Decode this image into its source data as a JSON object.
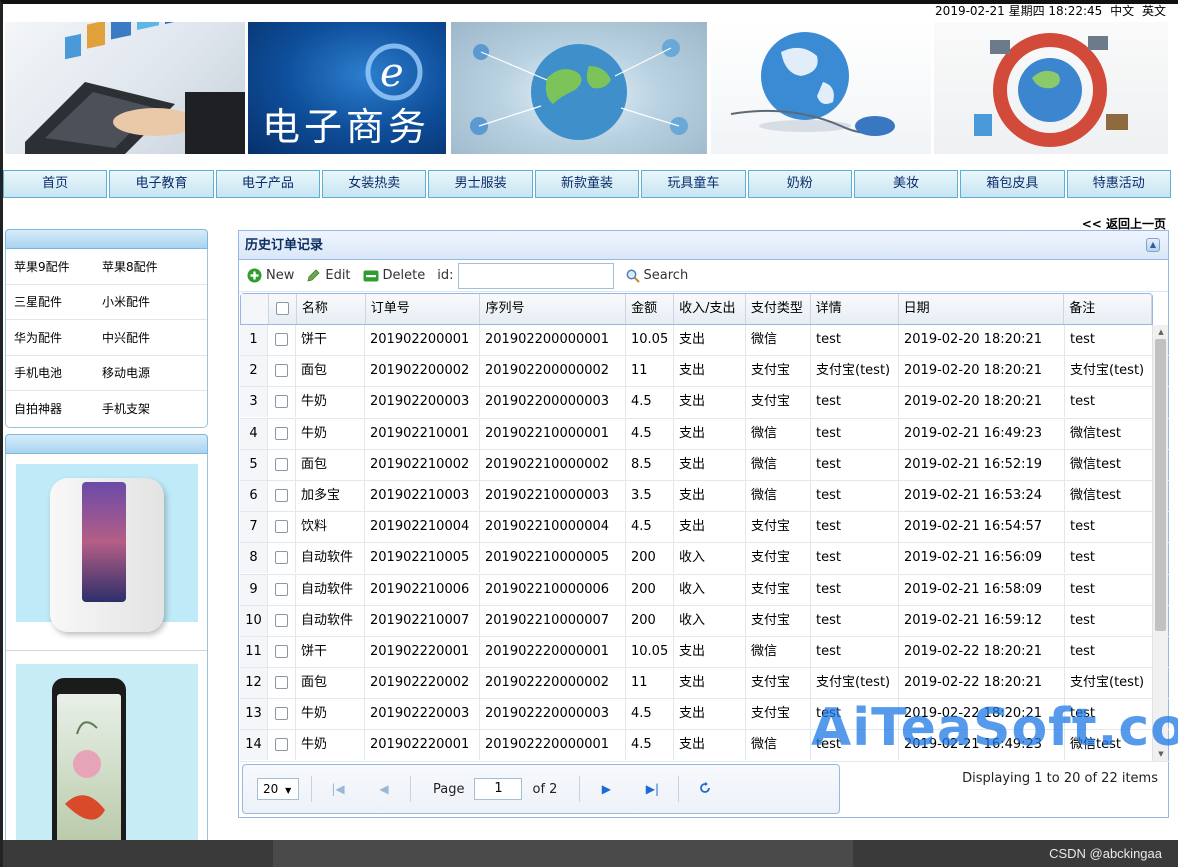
{
  "topbar": {
    "datetime": "2019-02-21 星期四 18:22:45",
    "lang_zh": "中文",
    "lang_en": "英文"
  },
  "banner": {
    "ecommerce_text": "电子商务",
    "ecommerce_letter": "e"
  },
  "nav": {
    "items": [
      "首页",
      "电子教育",
      "电子产品",
      "女装热卖",
      "男士服装",
      "新款童装",
      "玩具童车",
      "奶粉",
      "美妆",
      "箱包皮具",
      "特惠活动"
    ]
  },
  "back_link": "<< 返回上一页",
  "sidebar": {
    "categories": [
      [
        "苹果9配件",
        "苹果8配件"
      ],
      [
        "三星配件",
        "小米配件"
      ],
      [
        "华为配件",
        "中兴配件"
      ],
      [
        "手机电池",
        "移动电源"
      ],
      [
        "自拍神器",
        "手机支架"
      ]
    ]
  },
  "panel": {
    "title": "历史订单记录"
  },
  "toolbar": {
    "new_label": "New",
    "edit_label": "Edit",
    "delete_label": "Delete",
    "id_label": "id:",
    "id_value": "",
    "search_label": "Search"
  },
  "grid": {
    "columns": [
      "名称",
      "订单号",
      "序列号",
      "金额",
      "收入/支出",
      "支付类型",
      "详情",
      "日期",
      "备注"
    ],
    "rows": [
      [
        "1",
        "饼干",
        "201902200001",
        "201902200000001",
        "10.05",
        "支出",
        "微信",
        "test",
        "2019-02-20 18:20:21",
        "test"
      ],
      [
        "2",
        "面包",
        "201902200002",
        "201902200000002",
        "11",
        "支出",
        "支付宝",
        "支付宝(test)",
        "2019-02-20 18:20:21",
        "支付宝(test)"
      ],
      [
        "3",
        "牛奶",
        "201902200003",
        "201902200000003",
        "4.5",
        "支出",
        "支付宝",
        "test",
        "2019-02-20 18:20:21",
        "test"
      ],
      [
        "4",
        "牛奶",
        "201902210001",
        "201902210000001",
        "4.5",
        "支出",
        "微信",
        "test",
        "2019-02-21 16:49:23",
        "微信test"
      ],
      [
        "5",
        "面包",
        "201902210002",
        "201902210000002",
        "8.5",
        "支出",
        "微信",
        "test",
        "2019-02-21 16:52:19",
        "微信test"
      ],
      [
        "6",
        "加多宝",
        "201902210003",
        "201902210000003",
        "3.5",
        "支出",
        "微信",
        "test",
        "2019-02-21 16:53:24",
        "微信test"
      ],
      [
        "7",
        "饮料",
        "201902210004",
        "201902210000004",
        "4.5",
        "支出",
        "支付宝",
        "test",
        "2019-02-21 16:54:57",
        "test"
      ],
      [
        "8",
        "自动软件",
        "201902210005",
        "201902210000005",
        "200",
        "收入",
        "支付宝",
        "test",
        "2019-02-21 16:56:09",
        "test"
      ],
      [
        "9",
        "自动软件",
        "201902210006",
        "201902210000006",
        "200",
        "收入",
        "支付宝",
        "test",
        "2019-02-21 16:58:09",
        "test"
      ],
      [
        "10",
        "自动软件",
        "201902210007",
        "201902210000007",
        "200",
        "收入",
        "支付宝",
        "test",
        "2019-02-21 16:59:12",
        "test"
      ],
      [
        "11",
        "饼干",
        "201902220001",
        "201902220000001",
        "10.05",
        "支出",
        "微信",
        "test",
        "2019-02-22 18:20:21",
        "test"
      ],
      [
        "12",
        "面包",
        "201902220002",
        "201902220000002",
        "11",
        "支出",
        "支付宝",
        "支付宝(test)",
        "2019-02-22 18:20:21",
        "支付宝(test)"
      ],
      [
        "13",
        "牛奶",
        "201902220003",
        "201902220000003",
        "4.5",
        "支出",
        "支付宝",
        "test",
        "2019-02-22 18:20:21",
        "test"
      ],
      [
        "14",
        "牛奶",
        "201902220001",
        "201902220000001",
        "4.5",
        "支出",
        "微信",
        "test",
        "2019-02-21 16:49:23",
        "微信test"
      ]
    ]
  },
  "pager": {
    "page_size": "20",
    "page_label": "Page",
    "page_number": "1",
    "of_label": "of 2",
    "displaying": "Displaying 1 to 20 of 22 items"
  },
  "watermark": "AiTeaSoft.com",
  "footer": {
    "csdn": "CSDN @abckingaa"
  },
  "colors": {
    "nav_border": "#5bb0d4",
    "panel_border": "#95b8e7",
    "new_icon": "#2f9e2f",
    "watermark": "#1e78e6"
  },
  "icons": {
    "new": "plus-circle-icon",
    "edit": "pencil-icon",
    "delete": "minus-icon",
    "search": "magnifier-icon",
    "refresh": "refresh-icon"
  }
}
